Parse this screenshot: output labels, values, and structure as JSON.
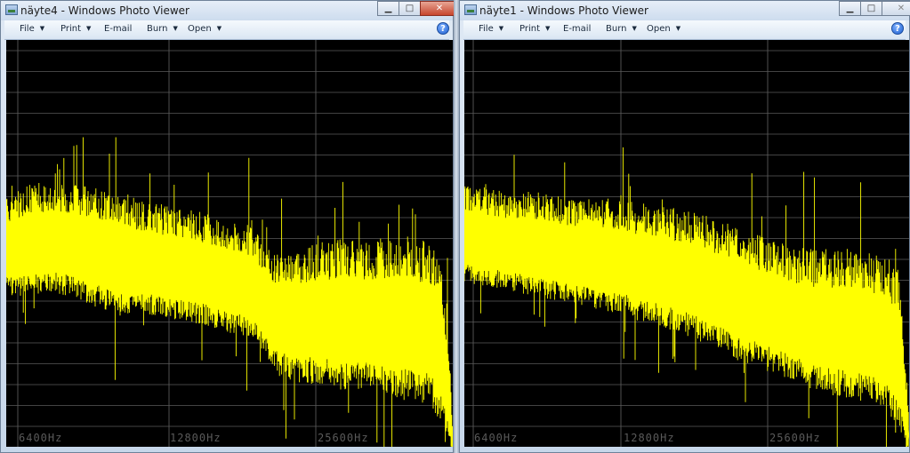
{
  "windows": [
    {
      "title": "näyte4 - Windows Photo Viewer",
      "menu": [
        "File",
        "Print",
        "E-mail",
        "Burn",
        "Open"
      ],
      "help": "?",
      "freq_labels": [
        "6400Hz",
        "12800Hz",
        "25600Hz"
      ]
    },
    {
      "title": "näyte1 - Windows Photo Viewer",
      "menu": [
        "File",
        "Print",
        "E-mail",
        "Burn",
        "Open"
      ],
      "help": "?",
      "freq_labels": [
        "6400Hz",
        "12800Hz",
        "25600Hz"
      ]
    }
  ],
  "controls": {
    "minimize": "▁",
    "maximize": "□",
    "close": "✕"
  },
  "colors": {
    "spectrum": "#ffff00",
    "grid": "#5a5a5a",
    "background": "#000000"
  },
  "chart_data": [
    {
      "type": "line",
      "x_scale": "log",
      "x_tick_labels": [
        "6400Hz",
        "12800Hz",
        "25600Hz"
      ],
      "series": [
        {
          "points_x_fraction": [
            0.0,
            0.05,
            0.1,
            0.15,
            0.2,
            0.25,
            0.3,
            0.35,
            0.4,
            0.45,
            0.5,
            0.55,
            0.58,
            0.6,
            0.65,
            0.7,
            0.75,
            0.8,
            0.85,
            0.9,
            0.95,
            0.97,
            0.99,
            1.0
          ],
          "level_top": [
            0.45,
            0.43,
            0.42,
            0.43,
            0.44,
            0.45,
            0.47,
            0.48,
            0.49,
            0.5,
            0.52,
            0.53,
            0.58,
            0.6,
            0.6,
            0.59,
            0.59,
            0.59,
            0.59,
            0.59,
            0.6,
            0.64,
            0.78,
            0.97
          ],
          "level_bottom": [
            0.58,
            0.58,
            0.57,
            0.58,
            0.6,
            0.62,
            0.62,
            0.63,
            0.64,
            0.65,
            0.67,
            0.68,
            0.72,
            0.76,
            0.78,
            0.78,
            0.79,
            0.79,
            0.8,
            0.81,
            0.82,
            0.86,
            0.93,
            1.0
          ]
        }
      ]
    },
    {
      "type": "line",
      "x_scale": "log",
      "x_tick_labels": [
        "6400Hz",
        "12800Hz",
        "25600Hz"
      ],
      "series": [
        {
          "points_x_fraction": [
            0.0,
            0.05,
            0.1,
            0.15,
            0.2,
            0.25,
            0.3,
            0.35,
            0.4,
            0.45,
            0.5,
            0.55,
            0.6,
            0.65,
            0.7,
            0.75,
            0.8,
            0.85,
            0.9,
            0.95,
            0.98,
            1.0
          ],
          "level_top": [
            0.42,
            0.43,
            0.44,
            0.44,
            0.45,
            0.46,
            0.46,
            0.47,
            0.48,
            0.49,
            0.5,
            0.52,
            0.54,
            0.56,
            0.58,
            0.6,
            0.61,
            0.61,
            0.62,
            0.63,
            0.68,
            0.95
          ],
          "level_bottom": [
            0.55,
            0.56,
            0.57,
            0.58,
            0.59,
            0.6,
            0.61,
            0.62,
            0.64,
            0.65,
            0.67,
            0.69,
            0.72,
            0.74,
            0.76,
            0.78,
            0.8,
            0.81,
            0.82,
            0.84,
            0.9,
            1.0
          ]
        }
      ]
    }
  ]
}
